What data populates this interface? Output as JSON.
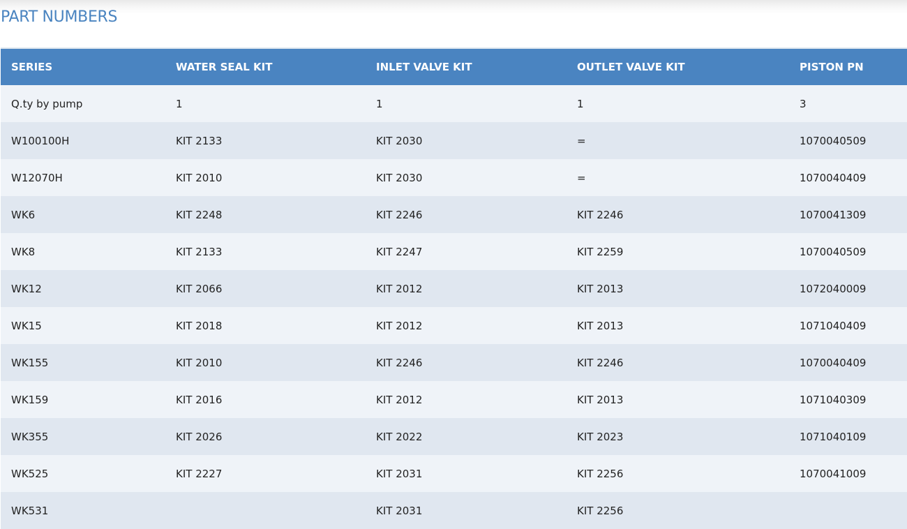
{
  "page": {
    "title": "PART NUMBERS"
  },
  "table": {
    "headers": [
      "SERIES",
      "WATER SEAL KIT",
      "INLET VALVE KIT",
      "OUTLET VALVE KIT",
      "PISTON PN"
    ],
    "rows": [
      [
        "Q.ty by pump",
        "1",
        "1",
        "1",
        "3"
      ],
      [
        "W100100H",
        "KIT 2133",
        "KIT 2030",
        "=",
        "1070040509"
      ],
      [
        "W12070H",
        "KIT 2010",
        "KIT 2030",
        "=",
        "1070040409"
      ],
      [
        "WK6",
        "KIT 2248",
        "KIT 2246",
        "KIT 2246",
        "1070041309"
      ],
      [
        "WK8",
        "KIT 2133",
        "KIT 2247",
        "KIT 2259",
        "1070040509"
      ],
      [
        "WK12",
        "KIT 2066",
        "KIT 2012",
        "KIT 2013",
        "1072040009"
      ],
      [
        "WK15",
        "KIT 2018",
        "KIT 2012",
        "KIT 2013",
        "1071040409"
      ],
      [
        "WK155",
        "KIT 2010",
        "KIT 2246",
        "KIT 2246",
        "1070040409"
      ],
      [
        "WK159",
        "KIT 2016",
        "KIT 2012",
        "KIT 2013",
        "1071040309"
      ],
      [
        "WK355",
        "KIT 2026",
        "KIT 2022",
        "KIT 2023",
        "1071040109"
      ],
      [
        "WK525",
        "KIT 2227",
        "KIT 2031",
        "KIT 2256",
        "1070041009"
      ],
      [
        "WK531",
        "",
        "KIT 2031",
        "KIT 2256",
        ""
      ]
    ]
  },
  "colors": {
    "title": "#4a84c0",
    "header_bg": "#4a84c1",
    "row_light": "#eff3f8",
    "row_dark": "#e0e7f0"
  }
}
